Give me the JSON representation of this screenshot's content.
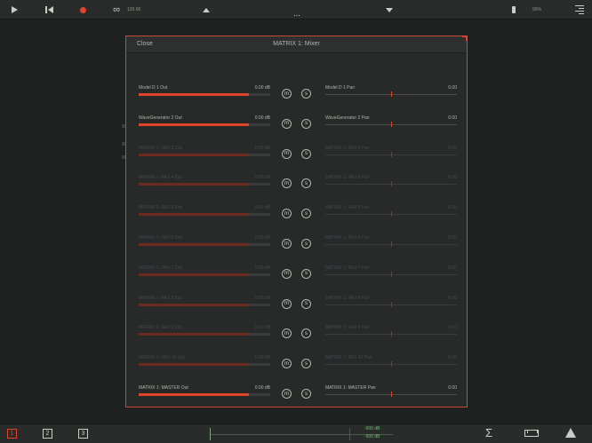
{
  "topbar": {
    "tempo": "120.00",
    "dots": "...",
    "battery": "90%"
  },
  "panel": {
    "close_label": "Close",
    "title": "MATRIX 1:  Mixer",
    "channels": [
      {
        "out_label": "Model D 1 Out",
        "out_db": "0.00 dB",
        "level": 0.84,
        "pan_label": "Model D 1 Pan",
        "pan_value": "0.00",
        "dim": false
      },
      {
        "out_label": "WaveGenerator 2 Out",
        "out_db": "0.00 dB",
        "level": 0.84,
        "pan_label": "WaveGenerator 2 Pan",
        "pan_value": "0.00",
        "dim": false
      },
      {
        "out_label": "MATRIX 1: FAU 3 Out",
        "out_db": "0.00 dB",
        "level": 0.84,
        "pan_label": "MATRIX 1: FAU 3 Pan",
        "pan_value": "0.00",
        "dim": true
      },
      {
        "out_label": "MATRIX 1: FAU 4 Out",
        "out_db": "0.00 dB",
        "level": 0.84,
        "pan_label": "MATRIX 1: FAU 4 Pan",
        "pan_value": "0.00",
        "dim": true
      },
      {
        "out_label": "MATRIX 1: FAU 5 Out",
        "out_db": "0.00 dB",
        "level": 0.84,
        "pan_label": "MATRIX 1: FAU 5 Pan",
        "pan_value": "0.00",
        "dim": true
      },
      {
        "out_label": "MATRIX 1: FAU 6 Out",
        "out_db": "0.00 dB",
        "level": 0.84,
        "pan_label": "MATRIX 1: FAU 6 Pan",
        "pan_value": "0.00",
        "dim": true
      },
      {
        "out_label": "MATRIX 1: FAU 7 Out",
        "out_db": "0.00 dB",
        "level": 0.84,
        "pan_label": "MATRIX 1: FAU 7 Pan",
        "pan_value": "0.00",
        "dim": true
      },
      {
        "out_label": "MATRIX 1: FAU 8 Out",
        "out_db": "0.00 dB",
        "level": 0.84,
        "pan_label": "MATRIX 1: FAU 8 Pan",
        "pan_value": "0.00",
        "dim": true
      },
      {
        "out_label": "MATRIX 1: FAU 9 Out",
        "out_db": "0.00 dB",
        "level": 0.84,
        "pan_label": "MATRIX 1: FAU 9 Pan",
        "pan_value": "0.00",
        "dim": true
      },
      {
        "out_label": "MATRIX 1: FAU 10 Out",
        "out_db": "0.00 dB",
        "level": 0.84,
        "pan_label": "MATRIX 1: FAU 10 Pan",
        "pan_value": "0.00",
        "dim": true
      },
      {
        "out_label": "MATRIX 1: MASTER Out",
        "out_db": "0.00 dB",
        "level": 0.84,
        "pan_label": "MATRIX 1: MASTER Pan",
        "pan_value": "0.00",
        "dim": false
      }
    ],
    "mute_label": "m",
    "solo_label": "s"
  },
  "bottombar": {
    "pages": [
      "1",
      "2",
      "3"
    ],
    "meter_value_1": "-900 dB",
    "meter_value_2": "-900 dB",
    "sigma": "Σ"
  }
}
